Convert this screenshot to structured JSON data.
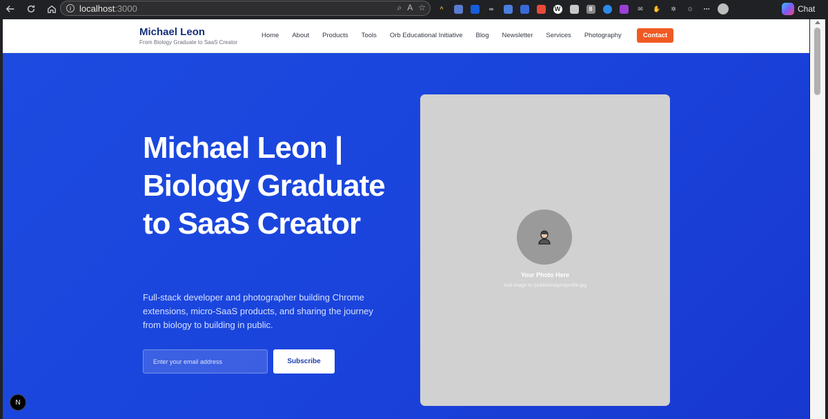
{
  "browser": {
    "url_host": "localhost",
    "url_port": ":3000",
    "chat_label": "Chat"
  },
  "header": {
    "brand_name": "Michael Leon",
    "brand_tagline": "From Biology Graduate to SaaS Creator",
    "nav": [
      "Home",
      "About",
      "Products",
      "Tools",
      "Orb Educational Initiative",
      "Blog",
      "Newsletter",
      "Services",
      "Photography"
    ],
    "contact_label": "Contact"
  },
  "hero": {
    "title": "Michael Leon | Biology Graduate to SaaS Creator",
    "subtitle": "Full-stack developer and photographer building Chrome extensions, micro-SaaS products, and sharing the journey from biology to building in public.",
    "email_placeholder": "Enter your email address",
    "subscribe_label": "Subscribe"
  },
  "photo": {
    "label": "Your Photo Here",
    "hint": "Add image to /public/images/profile.jpg"
  },
  "dev_badge": "N",
  "colors": {
    "brand_navy": "#14307a",
    "accent_orange": "#f05a22",
    "hero_blue": "#1d4be0"
  }
}
